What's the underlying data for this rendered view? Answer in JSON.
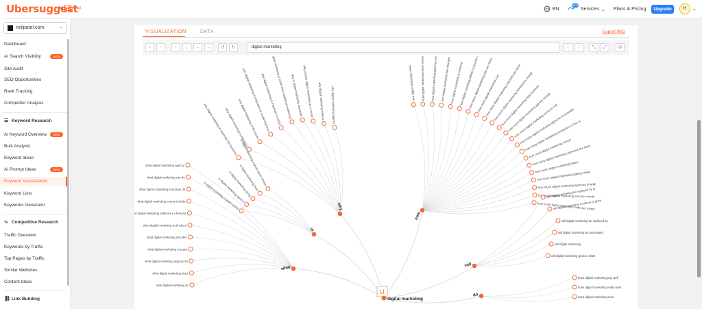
{
  "header": {
    "logo": "Ubersuggest",
    "logo_by": "by",
    "logo_np": "NP",
    "logo_partner": "digital",
    "language": "EN",
    "services": "Services",
    "services_badge": "NEW",
    "plans": "Plans & Pricing",
    "upgrade": "Upgrade",
    "avatar": "H"
  },
  "sidebar": {
    "domain": "neilpatel.com",
    "items_top": [
      "Dashboard",
      "AI Search Visibility",
      "Site Audit",
      "SEO Opportunities",
      "Rank Tracking",
      "Competitor Analysis"
    ],
    "keyword_section": "Keyword Research",
    "keyword_items": [
      "AI Keyword Overview",
      "Bulk Analysis",
      "Keyword Ideas",
      "AI Prompt Ideas",
      "Keyword Visualization",
      "Keyword Lists",
      "Keywords Generator"
    ],
    "competitive_section": "Competitive Research",
    "competitive_items": [
      "Traffic Overview",
      "Keywords by Traffic",
      "Top Pages by Traffic",
      "Similar Websites",
      "Content Ideas"
    ],
    "link_section": "Link Building",
    "new_badge": "NEW"
  },
  "main": {
    "tab_visualization": "VISUALIZATION",
    "tab_data": "DATA",
    "export": "Export IMG",
    "search_value": "digital marketing"
  },
  "viz": {
    "center_label": "digital marketing",
    "center_icon": "U",
    "hubs": [
      {
        "label": "what"
      },
      {
        "label": "is"
      },
      {
        "label": "why"
      },
      {
        "label": "how"
      },
      {
        "label": "will"
      },
      {
        "label": "do"
      }
    ],
    "leaves_what": [
      "what digital marketing do",
      "what digital marketing does",
      "what digital marketing agency do",
      "what digital marketing courses",
      "what digital marketing includes",
      "what digital marketing is all about",
      "what digital marketing skills are in demand",
      "what digital marketing course include",
      "what digital marketing executive do",
      "what digital marketing can do",
      "what digital marketing agency"
    ],
    "leaves_is": [
      "is digital marketing a good career",
      "is digital marketing worth it",
      "is digital marketing dying",
      "is digital marketing hard",
      "is digital marketing a good career choice"
    ],
    "leaves_why": [
      "why digital marketing is important for business",
      "why digital marketing is important",
      "why digital marketing is the future",
      "why digital marketing is important for small business",
      "why digital marketing is important in 2023",
      "why digital marketing is better than traditional marketing",
      "why is digital marketing important",
      "why choose digital marketing as a career",
      "why digital marketing matters",
      "why digital marketing agency"
    ],
    "leaves_how": [
      "how digital marketing works",
      "how digital marketing helps business",
      "how digital marketing agencies work",
      "how digital marketing has changed business",
      "how digital marketing is evolving",
      "how digital marketing affects consumer behavior",
      "how many digital marketing jobs are there",
      "how much digital marketing cost",
      "how many digital marketing channels are there",
      "how much digital marketing freelancers charge",
      "how much digital marketing help business",
      "how much digital marketing agency charge",
      "how much digital marketing services cost",
      "how many digital marketing agencies in australia",
      "how many digital marketing companies in the us",
      "how much digital marketing course",
      "how many digital marketing agencies are there",
      "how much digital marketing salary",
      "how much digital marketing agency make",
      "how much digital marketing agencies charge",
      "how much digital marketing earn per month",
      "how much digital marketing make per month"
    ],
    "leaves_will": [
      "will digital marketing be replaced by ai",
      "will digital marketing continue to grow",
      "will digital marketing be replaced by",
      "will digital marketing be automated",
      "will digital marketing",
      "will digital marketing grow in 2023"
    ],
    "leaves_do": [
      "does digital marketing pay well",
      "does digital marketing really work",
      "does digital marketing work"
    ]
  }
}
